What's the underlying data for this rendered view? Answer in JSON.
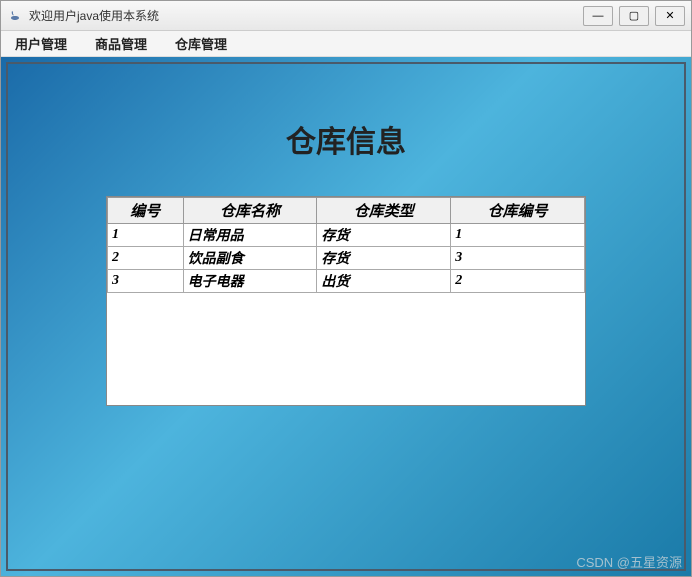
{
  "window": {
    "title": "欢迎用户java使用本系统"
  },
  "menu": {
    "items": [
      {
        "label": "用户管理"
      },
      {
        "label": "商品管理"
      },
      {
        "label": "仓库管理"
      }
    ]
  },
  "page": {
    "heading": "仓库信息"
  },
  "table": {
    "headers": [
      "编号",
      "仓库名称",
      "仓库类型",
      "仓库编号"
    ],
    "rows": [
      [
        "1",
        "日常用品",
        "存货",
        "1"
      ],
      [
        "2",
        "饮品副食",
        "存货",
        "3"
      ],
      [
        "3",
        "电子电器",
        "出货",
        "2"
      ]
    ]
  },
  "watermark": "CSDN @五星资源",
  "icons": {
    "minimize": "—",
    "maximize": "▢",
    "close": "✕"
  }
}
